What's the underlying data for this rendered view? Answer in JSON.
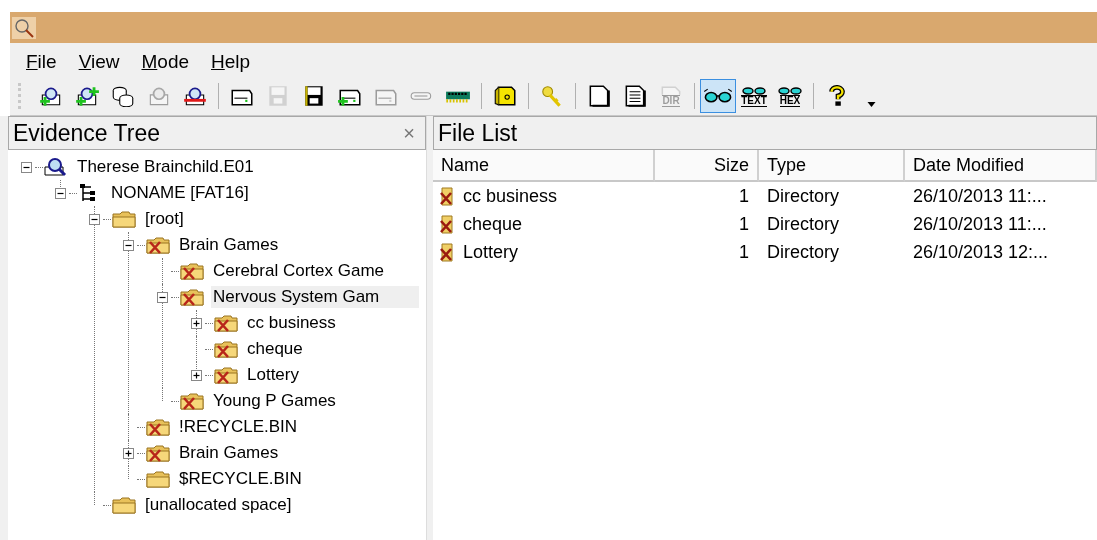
{
  "menu": [
    {
      "label": "File"
    },
    {
      "label": "View"
    },
    {
      "label": "Mode"
    },
    {
      "label": "Help"
    }
  ],
  "toolbar": [
    {
      "kind": "add-evidence",
      "disabled": false,
      "selected": false
    },
    {
      "kind": "add-image",
      "disabled": false,
      "selected": false
    },
    {
      "kind": "databases",
      "disabled": false,
      "selected": false
    },
    {
      "kind": "remove-all",
      "disabled": true,
      "selected": false
    },
    {
      "kind": "remove-evidence",
      "disabled": false,
      "selected": false
    },
    {
      "kind": "separator"
    },
    {
      "kind": "drive",
      "disabled": false,
      "selected": false
    },
    {
      "kind": "save",
      "disabled": true,
      "selected": false
    },
    {
      "kind": "save-image",
      "disabled": false,
      "selected": false
    },
    {
      "kind": "add-drive",
      "disabled": false,
      "selected": false
    },
    {
      "kind": "drive",
      "disabled": true,
      "selected": false
    },
    {
      "kind": "usb",
      "disabled": true,
      "selected": false
    },
    {
      "kind": "memory",
      "disabled": false,
      "selected": false
    },
    {
      "kind": "separator"
    },
    {
      "kind": "safe",
      "disabled": false,
      "selected": false
    },
    {
      "kind": "separator"
    },
    {
      "kind": "key",
      "disabled": false,
      "selected": false
    },
    {
      "kind": "separator"
    },
    {
      "kind": "blank-page",
      "disabled": false,
      "selected": false
    },
    {
      "kind": "text-page",
      "disabled": false,
      "selected": false
    },
    {
      "kind": "labeled-page",
      "label": "DIR",
      "disabled": true,
      "selected": false
    },
    {
      "kind": "separator"
    },
    {
      "kind": "glasses",
      "disabled": false,
      "selected": true
    },
    {
      "kind": "labeled-glasses",
      "label": "TEXT",
      "disabled": false,
      "selected": false
    },
    {
      "kind": "labeled-glasses",
      "label": "HEX",
      "disabled": false,
      "selected": false
    },
    {
      "kind": "separator"
    },
    {
      "kind": "help",
      "disabled": false,
      "selected": false
    }
  ],
  "evidence_tree": {
    "title": "Evidence Tree",
    "close": "×",
    "nodes": [
      {
        "label": "Therese Brainchild.E01",
        "kind": "evidence",
        "selected": false,
        "expanded": true,
        "children": [
          {
            "label": "NONAME [FAT16]",
            "kind": "volume",
            "selected": false,
            "expanded": true,
            "children": [
              {
                "label": "[root]",
                "kind": "folder",
                "deleted": false,
                "selected": false,
                "expanded": true,
                "children": [
                  {
                    "label": "Brain Games",
                    "kind": "folder",
                    "deleted": true,
                    "selected": false,
                    "expanded": true,
                    "children": [
                      {
                        "label": "Cerebral  Cortex Game",
                        "kind": "folder",
                        "deleted": true,
                        "selected": false
                      },
                      {
                        "label": "Nervous System Gam",
                        "kind": "folder",
                        "deleted": true,
                        "selected": true,
                        "expanded": true,
                        "children": [
                          {
                            "label": "cc business",
                            "kind": "folder",
                            "deleted": true,
                            "selected": false,
                            "expanded": false
                          },
                          {
                            "label": "cheque",
                            "kind": "folder",
                            "deleted": true,
                            "selected": false
                          },
                          {
                            "label": "Lottery",
                            "kind": "folder",
                            "deleted": true,
                            "selected": false,
                            "expanded": false
                          }
                        ]
                      },
                      {
                        "label": "Young P Games",
                        "kind": "folder",
                        "deleted": true,
                        "selected": false
                      }
                    ]
                  },
                  {
                    "label": "!RECYCLE.BIN",
                    "kind": "folder",
                    "deleted": true,
                    "selected": false
                  },
                  {
                    "label": "Brain Games",
                    "kind": "folder",
                    "deleted": true,
                    "selected": false,
                    "expanded": false
                  },
                  {
                    "label": "$RECYCLE.BIN",
                    "kind": "folder",
                    "deleted": false,
                    "selected": false
                  }
                ]
              },
              {
                "label": "[unallocated space]",
                "kind": "folder",
                "deleted": false,
                "selected": false
              }
            ]
          }
        ]
      }
    ]
  },
  "file_list": {
    "title": "File List",
    "columns": [
      "Name",
      "Size",
      "Type",
      "Date Modified"
    ],
    "rows": [
      {
        "name": "cc business",
        "size": "1",
        "type": "Directory",
        "date_modified": "26/10/2013 11:...",
        "deleted": true
      },
      {
        "name": "cheque",
        "size": "1",
        "type": "Directory",
        "date_modified": "26/10/2013 11:...",
        "deleted": true
      },
      {
        "name": "Lottery",
        "size": "1",
        "type": "Directory",
        "date_modified": "26/10/2013 12:...",
        "deleted": true
      }
    ]
  }
}
